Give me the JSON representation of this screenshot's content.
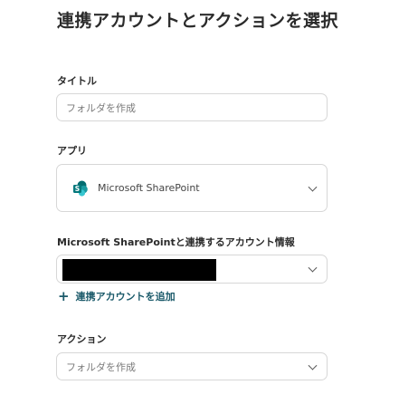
{
  "page_title": "連携アカウントとアクションを選択",
  "title_field": {
    "label": "タイトル",
    "value": "フォルダを作成"
  },
  "app_field": {
    "label": "アプリ",
    "selected": "Microsoft SharePoint",
    "icon": "sharepoint-icon"
  },
  "account_field": {
    "label": "Microsoft SharePointと連携するアカウント情報",
    "selected": ""
  },
  "add_account": {
    "icon": "plus-icon",
    "label": "連携アカウントを追加"
  },
  "action_field": {
    "label": "アクション",
    "selected": "フォルダを作成"
  },
  "colors": {
    "link": "#1b5a6a",
    "sharepoint_dark": "#036c70",
    "sharepoint_mid": "#1a9ba1",
    "sharepoint_light": "#37c6d0",
    "border": "#d7d7d7"
  }
}
